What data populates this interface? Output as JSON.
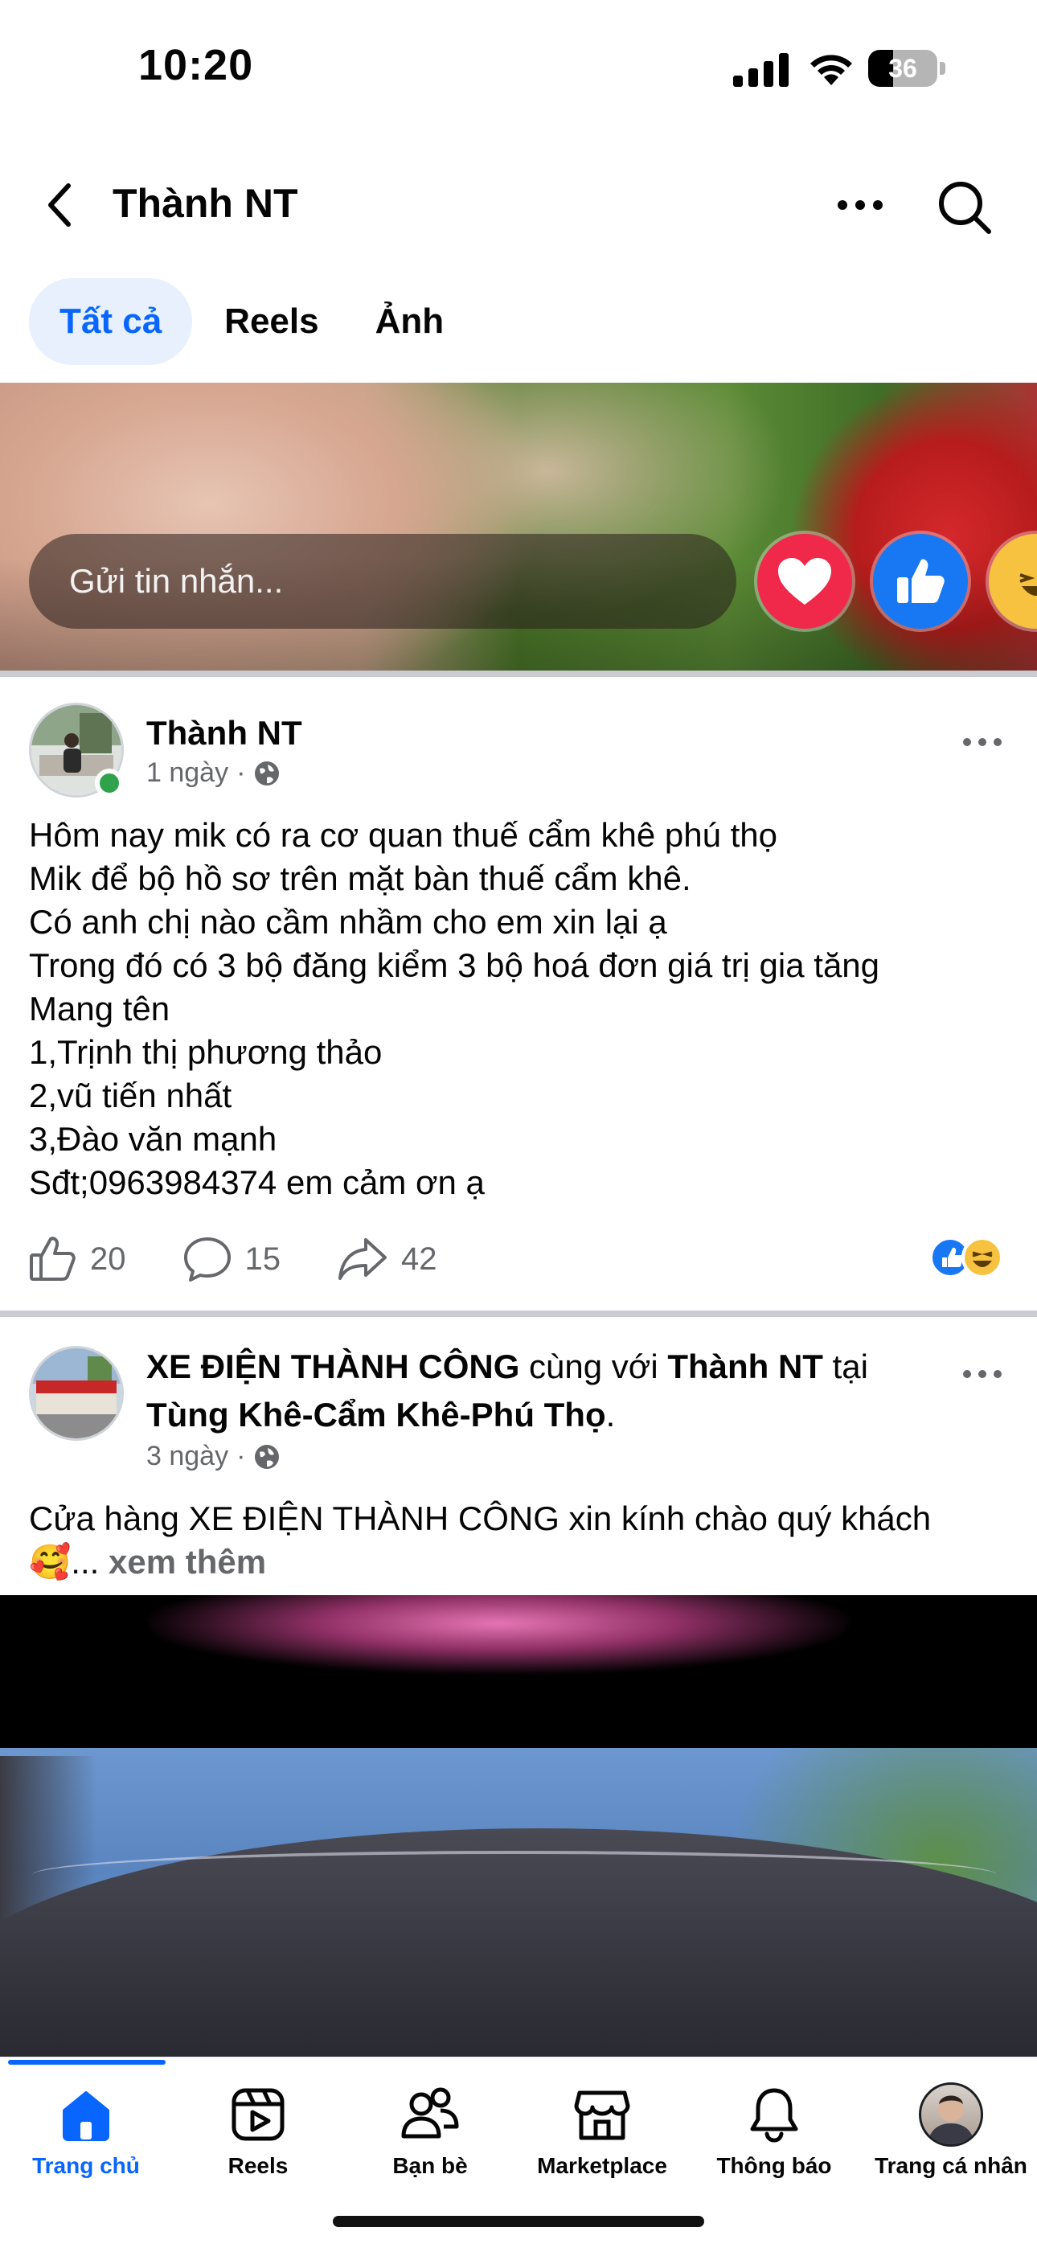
{
  "status_bar": {
    "time": "10:20",
    "battery": "36",
    "battery_level": 0.36
  },
  "header": {
    "title": "Thành NT"
  },
  "tabs": [
    {
      "label": "Tất cả",
      "active": true
    },
    {
      "label": "Reels",
      "active": false
    },
    {
      "label": "Ảnh",
      "active": false
    }
  ],
  "story": {
    "message_placeholder": "Gửi tin nhắn...",
    "reactions": [
      "heart-icon",
      "like-icon",
      "haha-icon"
    ]
  },
  "post1": {
    "author": "Thành NT",
    "time": "1 ngày",
    "privacy_icon": "globe-icon",
    "lines": [
      "Hôm nay mik có ra cơ quan thuế cẩm khê phú thọ",
      "Mik để bộ hồ sơ trên mặt bàn thuế cẩm khê.",
      "Có anh chị nào cầm nhầm cho em xin lại ạ",
      "Trong đó có 3 bộ đăng kiểm 3 bộ hoá đơn giá trị gia tăng",
      "Mang tên",
      "1,Trịnh thị phương thảo",
      "2,vũ tiến nhất",
      "3,Đào văn mạnh",
      "Sđt;0963984374 em cảm ơn ạ"
    ],
    "likes": "20",
    "comments": "15",
    "shares": "42"
  },
  "post2": {
    "page_name": "XE ĐIỆN THÀNH CÔNG",
    "with_text": " cùng với ",
    "tagged": "Thành NT",
    "at_text": " tại",
    "location": "Tùng Khê-Cẩm Khê-Phú Thọ",
    "location_end": ".",
    "time": "3 ngày",
    "body": "Cửa hàng XE ĐIỆN THÀNH CÔNG xin kính chào quý khách",
    "emoji": "🥰",
    "ellipsis": "... ",
    "see_more": "xem thêm"
  },
  "bottom_nav": [
    {
      "label": "Trang chủ",
      "icon": "home-icon",
      "active": true
    },
    {
      "label": "Reels",
      "icon": "reels-icon",
      "active": false
    },
    {
      "label": "Bạn bè",
      "icon": "friends-icon",
      "active": false
    },
    {
      "label": "Marketplace",
      "icon": "marketplace-icon",
      "active": false
    },
    {
      "label": "Thông báo",
      "icon": "bell-icon",
      "active": false
    },
    {
      "label": "Trang cá nhân",
      "icon": "profile-avatar",
      "active": false
    }
  ],
  "colors": {
    "accent": "#0866ff",
    "secondary_text": "#65676b",
    "online": "#31a24c"
  }
}
